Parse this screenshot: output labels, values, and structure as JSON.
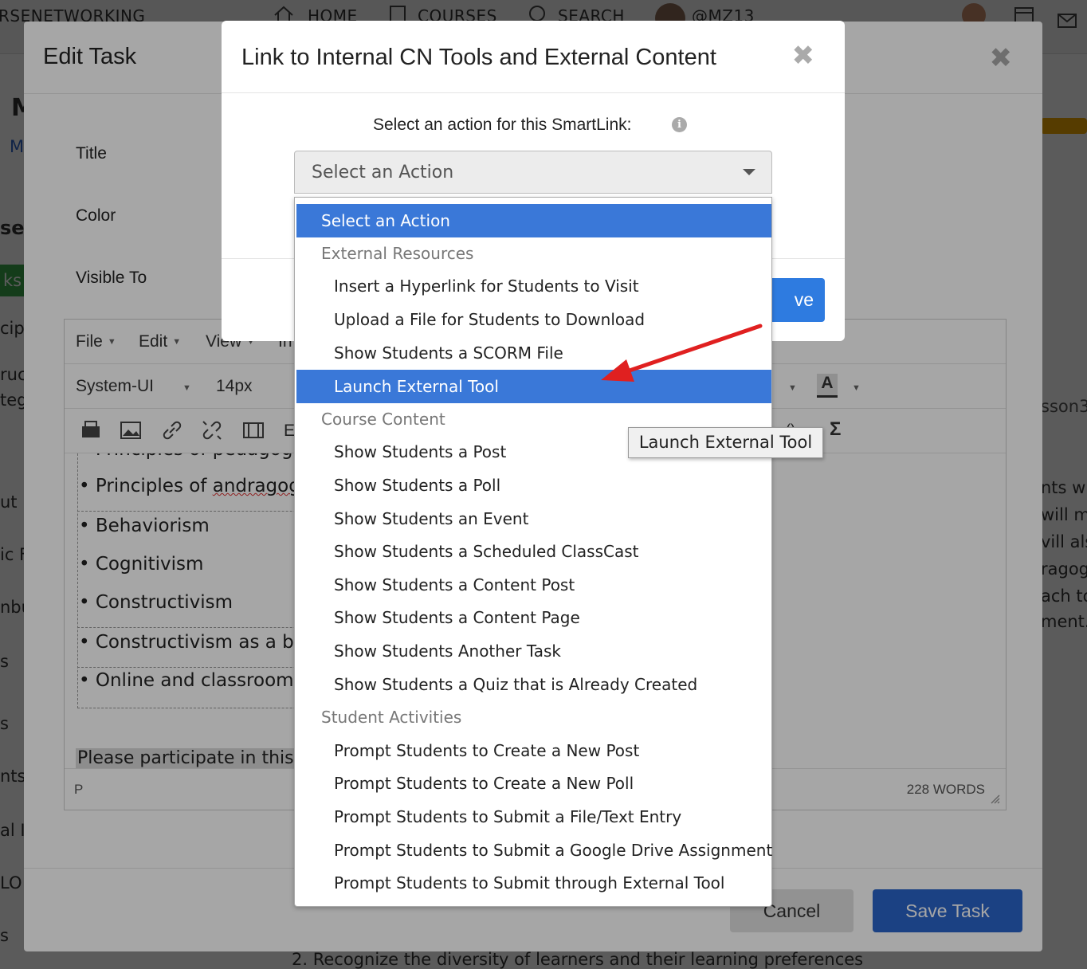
{
  "background": {
    "topbar": {
      "brand": "RSENETWORKING",
      "nav": [
        "HOME",
        "COURSES",
        "SEARCH",
        "@MZ13"
      ]
    },
    "fragments": {
      "m_letter": "M",
      "m_link": "M",
      "se": "se",
      "ks_badge": "ks",
      "cip": "cip",
      "ruc": "ruc",
      "teg": "teg",
      "ut": "ut",
      "ic": "ic F",
      "bu": "nbu",
      "s1": "s",
      "s2": "s",
      "nts": "nts",
      "al": "al I",
      "lo": "LO",
      "s3": "s",
      "sson3": "sson3",
      "r1": "nts wi",
      "r2": "will m",
      "r3": "vill als",
      "r4": "ragog",
      "r5": "ach to",
      "r6": "ment.",
      "bottom_text": "2. Recognize the diversity of learners and their learning preferences"
    }
  },
  "edit_task": {
    "title": "Edit Task",
    "close": "✖",
    "labels": {
      "title": "Title",
      "color": "Color",
      "visible_to": "Visible To"
    },
    "editor": {
      "menus": [
        "File",
        "Edit",
        "View",
        "In"
      ],
      "font_family": "System-UI",
      "font_size": "14px",
      "toolbar_tail_letter": "E",
      "bullets": [
        "• Principles of pedagogy",
        "• Principles of ",
        "• Behaviorism",
        "• Cognitivism",
        "• Constructivism",
        "• Constructivism as a be",
        "• Online and classroom"
      ],
      "wavy_word": "andragogy",
      "paragraph": "Please participate in this e",
      "status_path": "P",
      "word_count": "228 WORDS"
    },
    "buttons": {
      "cancel": "Cancel",
      "save": "Save Task"
    }
  },
  "link_modal": {
    "title": "Link to Internal CN Tools and External Content",
    "close": "✖",
    "prompt": "Select an action for this SmartLink:",
    "info_icon": "i",
    "select_value": "Select an Action",
    "save_button_partial": "ve",
    "accent_color": "#3a78d8"
  },
  "dropdown": {
    "options": [
      {
        "label": "Select an Action",
        "kind": "top",
        "selected": true
      },
      {
        "label": "External Resources",
        "kind": "group"
      },
      {
        "label": "Insert a Hyperlink for Students to Visit",
        "kind": "child"
      },
      {
        "label": "Upload a File for Students to Download",
        "kind": "child"
      },
      {
        "label": "Show Students a SCORM File",
        "kind": "child"
      },
      {
        "label": "Launch External Tool",
        "kind": "child",
        "selected": true
      },
      {
        "label": "Course Content",
        "kind": "group"
      },
      {
        "label": "Show Students a Post",
        "kind": "child"
      },
      {
        "label": "Show Students a Poll",
        "kind": "child"
      },
      {
        "label": "Show Students an Event",
        "kind": "child"
      },
      {
        "label": "Show Students a Scheduled ClassCast",
        "kind": "child"
      },
      {
        "label": "Show Students a Content Post",
        "kind": "child"
      },
      {
        "label": "Show Students a Content Page",
        "kind": "child"
      },
      {
        "label": "Show Students Another Task",
        "kind": "child"
      },
      {
        "label": "Show Students a Quiz that is Already Created",
        "kind": "child"
      },
      {
        "label": "Student Activities",
        "kind": "group"
      },
      {
        "label": "Prompt Students to Create a New Post",
        "kind": "child"
      },
      {
        "label": "Prompt Students to Create a New Poll",
        "kind": "child"
      },
      {
        "label": "Prompt Students to Submit a File/Text Entry",
        "kind": "child"
      },
      {
        "label": "Prompt Students to Submit a Google Drive Assignment",
        "kind": "child"
      },
      {
        "label": "Prompt Students to Submit through External Tool",
        "kind": "child"
      }
    ],
    "tooltip": "Launch External Tool"
  },
  "annotation": {
    "arrow_color": "#e02020"
  }
}
